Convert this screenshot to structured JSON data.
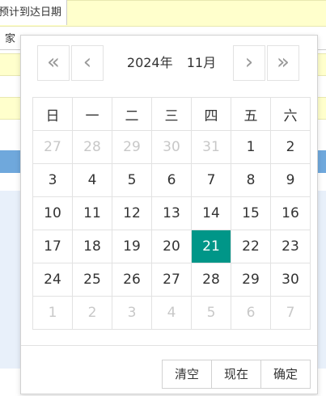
{
  "background": {
    "label_top": "预计到达日期",
    "label_second": "家"
  },
  "picker": {
    "year": "2024年",
    "month": "11月",
    "nav": {
      "prev_year": "«",
      "prev_month": "‹",
      "next_month": "›",
      "next_year": "»"
    },
    "weekdays": [
      "日",
      "一",
      "二",
      "三",
      "四",
      "五",
      "六"
    ],
    "weeks": [
      [
        "27",
        "28",
        "29",
        "30",
        "31",
        "1",
        "2"
      ],
      [
        "3",
        "4",
        "5",
        "6",
        "7",
        "8",
        "9"
      ],
      [
        "10",
        "11",
        "12",
        "13",
        "14",
        "15",
        "16"
      ],
      [
        "17",
        "18",
        "19",
        "20",
        "21",
        "22",
        "23"
      ],
      [
        "24",
        "25",
        "26",
        "27",
        "28",
        "29",
        "30"
      ],
      [
        "1",
        "2",
        "3",
        "4",
        "5",
        "6",
        "7"
      ]
    ],
    "selected_day": "21",
    "buttons": {
      "clear": "清空",
      "now": "现在",
      "confirm": "确定"
    }
  }
}
